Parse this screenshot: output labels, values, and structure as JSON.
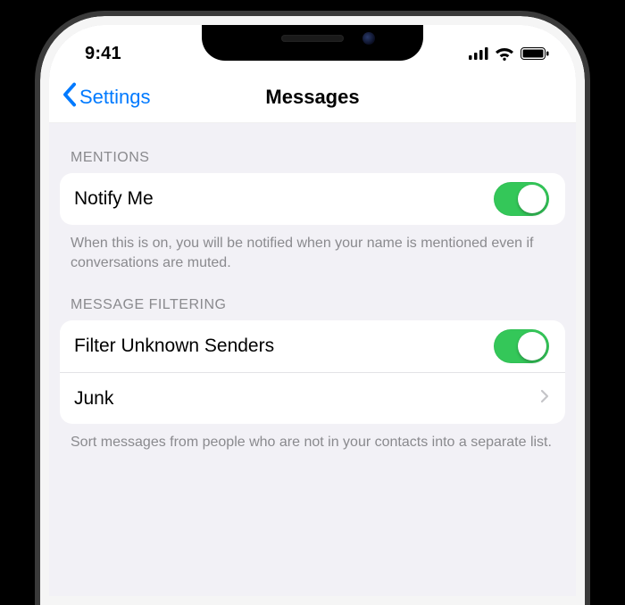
{
  "status": {
    "time": "9:41"
  },
  "nav": {
    "back_label": "Settings",
    "title": "Messages"
  },
  "sections": {
    "mentions": {
      "header": "MENTIONS",
      "notify_me_label": "Notify Me",
      "notify_me_on": true,
      "footer": "When this is on, you will be notified when your name is mentioned even if conversations are muted."
    },
    "filtering": {
      "header": "MESSAGE FILTERING",
      "filter_label": "Filter Unknown Senders",
      "filter_on": true,
      "junk_label": "Junk",
      "footer": "Sort messages from people who are not in your contacts into a separate list."
    }
  }
}
